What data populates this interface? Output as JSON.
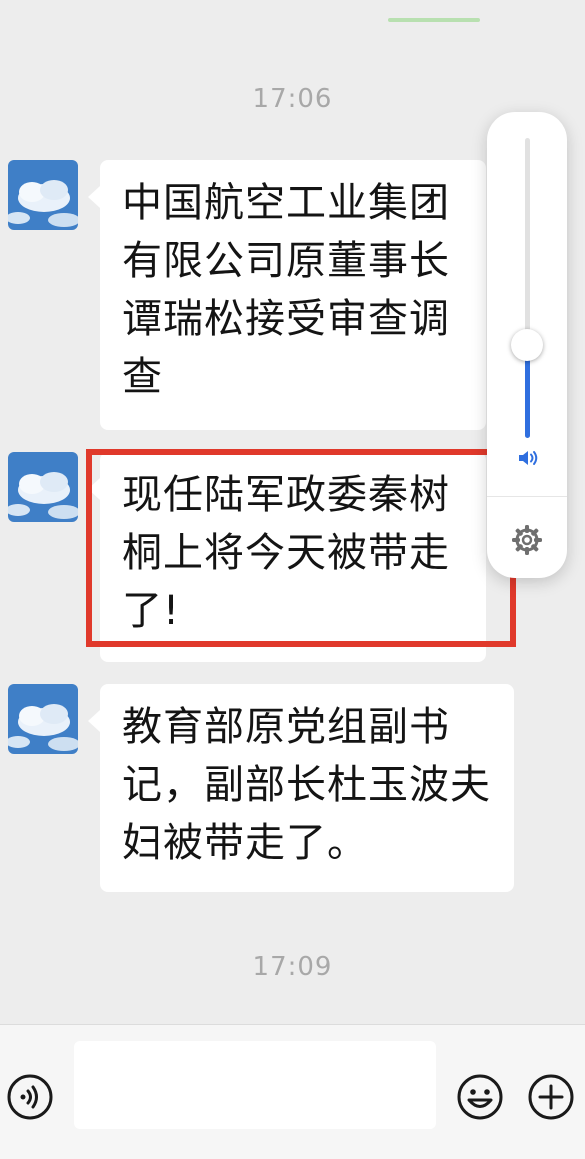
{
  "chat": {
    "timestamp_1": "17:06",
    "timestamp_2": "17:09",
    "messages": [
      {
        "text": "中国航空工业集团有限公司原董事长谭瑞松接受审查调查"
      },
      {
        "text": "现任陆军政委秦树桐上将今天被带走了!"
      },
      {
        "text": "教育部原党组副书记，副部长杜玉波夫妇被带走了。"
      }
    ]
  },
  "volume_control": {
    "level": 0.31,
    "accent": "#2f6fdf",
    "icons": [
      "speaker-icon",
      "gear-icon"
    ]
  },
  "highlight": {
    "color": "#e0392b",
    "target_message_index": 1
  },
  "input_bar": {
    "input_value": "",
    "icons": [
      "voice-icon",
      "emoji-icon",
      "plus-icon"
    ]
  }
}
